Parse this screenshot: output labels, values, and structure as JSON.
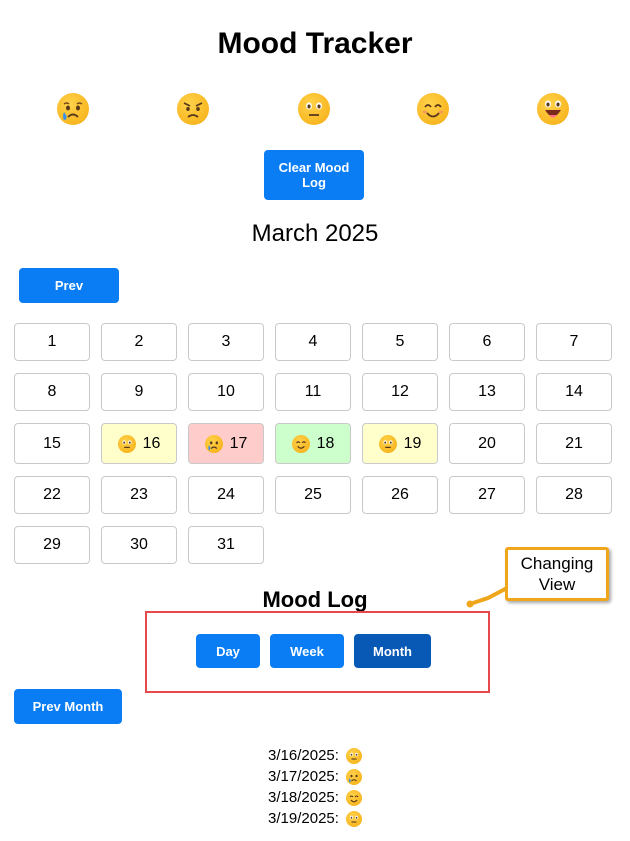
{
  "app": {
    "title": "Mood Tracker"
  },
  "mood_options": [
    {
      "name": "sad",
      "icon": "crying-face-icon"
    },
    {
      "name": "angry",
      "icon": "angry-face-icon"
    },
    {
      "name": "neutral",
      "icon": "neutral-face-icon"
    },
    {
      "name": "happy",
      "icon": "smiling-face-icon"
    },
    {
      "name": "very-happy",
      "icon": "grinning-face-icon"
    }
  ],
  "actions": {
    "clear_log_label": "Clear Mood Log"
  },
  "calendar": {
    "month_title": "March 2025",
    "prev_label": "Prev",
    "days": [
      {
        "day": "1"
      },
      {
        "day": "2"
      },
      {
        "day": "3"
      },
      {
        "day": "4"
      },
      {
        "day": "5"
      },
      {
        "day": "6"
      },
      {
        "day": "7"
      },
      {
        "day": "8"
      },
      {
        "day": "9"
      },
      {
        "day": "10"
      },
      {
        "day": "11"
      },
      {
        "day": "12"
      },
      {
        "day": "13"
      },
      {
        "day": "14"
      },
      {
        "day": "15"
      },
      {
        "day": "16",
        "mood": "neutral",
        "color": "#ffffcc"
      },
      {
        "day": "17",
        "mood": "sad",
        "color": "#ffcccc"
      },
      {
        "day": "18",
        "mood": "happy",
        "color": "#ccffcc"
      },
      {
        "day": "19",
        "mood": "neutral",
        "color": "#ffffcc"
      },
      {
        "day": "20"
      },
      {
        "day": "21"
      },
      {
        "day": "22"
      },
      {
        "day": "23"
      },
      {
        "day": "24"
      },
      {
        "day": "25"
      },
      {
        "day": "26"
      },
      {
        "day": "27"
      },
      {
        "day": "28"
      },
      {
        "day": "29"
      },
      {
        "day": "30"
      },
      {
        "day": "31"
      }
    ]
  },
  "mood_log": {
    "title": "Mood Log",
    "view_buttons": {
      "day": "Day",
      "week": "Week",
      "month": "Month"
    },
    "active_view": "Month",
    "prev_month_label": "Prev Month",
    "entries": [
      {
        "date": "3/16/2025:",
        "mood": "neutral"
      },
      {
        "date": "3/17/2025:",
        "mood": "sad"
      },
      {
        "date": "3/18/2025:",
        "mood": "happy"
      },
      {
        "date": "3/19/2025:",
        "mood": "neutral"
      }
    ]
  },
  "annotation": {
    "callout_line1": "Changing",
    "callout_line2": "View"
  },
  "colors": {
    "primary_button": "#0a7df5",
    "active_button": "#0759b5",
    "highlight_border": "#e5484d",
    "callout_border": "#f0a61b",
    "emoji_face": "#f8b722"
  }
}
